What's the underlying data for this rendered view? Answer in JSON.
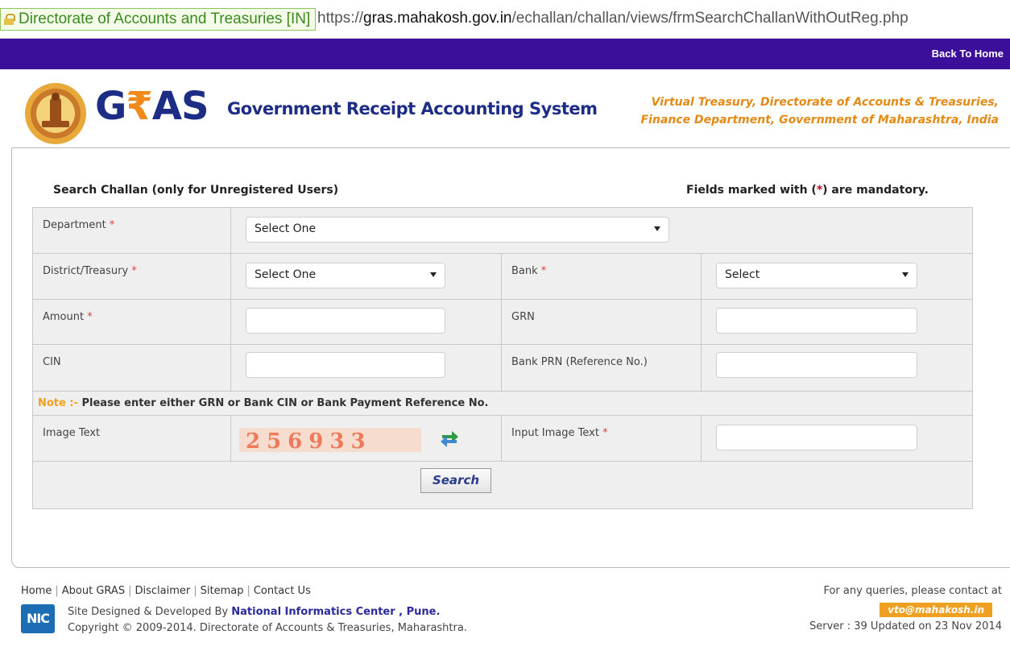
{
  "browser": {
    "identity": "Directorate of Accounts and Treasuries [IN]",
    "url_prefix": "https://",
    "url_host": "gras.mahakosh.gov.in",
    "url_path": "/echallan/challan/views/frmSearchChallanWithOutReg.php"
  },
  "topbar": {
    "back_home": "Back To Home"
  },
  "header": {
    "logo_g": "G",
    "logo_rupee": "₹",
    "logo_as": "AS",
    "logo_subtitle": "Government Receipt Accounting System",
    "tagline_line1": "Virtual Treasury, Directorate of Accounts & Treasuries,",
    "tagline_line2": "Finance Department, Government of Maharashtra, India"
  },
  "form": {
    "title": "Search Challan (only for Unregistered Users)",
    "mandatory_prefix": "Fields marked with (",
    "mandatory_star": "*",
    "mandatory_suffix": ") are mandatory.",
    "required_mark": "*",
    "department": {
      "label": "Department",
      "selected": "Select One"
    },
    "district": {
      "label": "District/Treasury",
      "selected": "Select One"
    },
    "bank": {
      "label": "Bank",
      "selected": "Select"
    },
    "amount": {
      "label": "Amount",
      "value": ""
    },
    "grn": {
      "label": "GRN",
      "value": ""
    },
    "cin": {
      "label": "CIN",
      "value": ""
    },
    "bank_prn": {
      "label": "Bank PRN (Reference No.)",
      "value": ""
    },
    "note_label": "Note :-",
    "note_text": " Please enter either GRN or Bank CIN or Bank Payment Reference No.",
    "image_text": {
      "label": "Image Text",
      "captcha": "256933"
    },
    "input_image_text": {
      "label": "Input Image Text",
      "value": ""
    },
    "search_button": "Search"
  },
  "footer": {
    "links": [
      "Home",
      "About GRAS",
      "Disclaimer",
      "Sitemap",
      "Contact Us"
    ],
    "nic_logo": "NIC",
    "designed_prefix": "Site Designed & Developed By ",
    "designed_org": "National Informatics Center , Pune.",
    "copyright": "Copyright © 2009-2014. Directorate of Accounts & Treasuries, Maharashtra.",
    "contact_text": "For any queries, please contact at",
    "contact_email": "vto@mahakosh.in",
    "server": "Server : 39 Updated on 23 Nov 2014"
  },
  "colors": {
    "topbar": "#3b0f9a",
    "logo_blue": "#1d2d86",
    "logo_orange": "#f08a1c",
    "required": "#d0021b",
    "note": "#f0a020"
  }
}
